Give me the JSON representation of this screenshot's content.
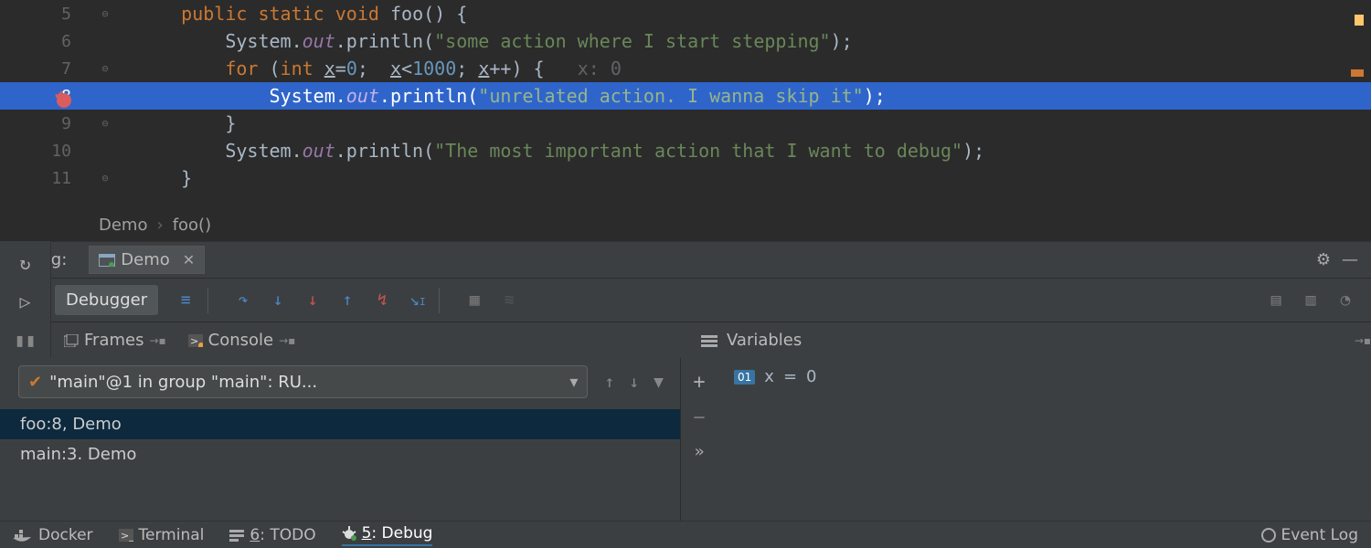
{
  "editor": {
    "lines": [
      {
        "num": "5"
      },
      {
        "num": "6"
      },
      {
        "num": "7",
        "inlay": "x: 0"
      },
      {
        "num": "8"
      },
      {
        "num": "9"
      },
      {
        "num": "10"
      },
      {
        "num": "11"
      }
    ],
    "tokens": {
      "l5_kw1": "public",
      "l5_kw2": "static",
      "l5_kw3": "void",
      "l5_fn": "foo",
      "l5_tail": "() {",
      "l6_pre": "        System.",
      "l6_out": "out",
      "l6_mid": ".println(",
      "l6_str": "\"some action where I start stepping\"",
      "l6_end": ");",
      "l7_pre": "        ",
      "l7_for": "for",
      "l7_a": " (",
      "l7_int": "int",
      "l7_b": " ",
      "l7_x": "x",
      "l7_eq": "=",
      "l7_z": "0",
      "l7_c": ";  ",
      "l7_x2": "x",
      "l7_lt": "<",
      "l7_k": "1000",
      "l7_d": "; ",
      "l7_x3": "x",
      "l7_pp": "++) {",
      "l8_pre": "            System.",
      "l8_out": "out",
      "l8_mid": ".println(",
      "l8_str": "\"unrelated action. I wanna skip it\"",
      "l8_end": ");",
      "l9_pre": "        }",
      "l10_pre": "        System.",
      "l10_out": "out",
      "l10_mid": ".println(",
      "l10_str": "\"The most important action that I want to debug\"",
      "l10_end": ");",
      "l11_pre": "    }"
    }
  },
  "breadcrumb": {
    "cls": "Demo",
    "method": "foo()"
  },
  "debug_header": {
    "label": "Debug:",
    "tab": "Demo"
  },
  "toolbar": {
    "debugger_tab": "Debugger"
  },
  "panel_tabs": {
    "frames": "Frames",
    "console": "Console"
  },
  "frames": {
    "thread": "\"main\"@1 in group \"main\": RU...",
    "items": [
      "foo:8, Demo",
      "main:3. Demo"
    ]
  },
  "variables": {
    "title": "Variables",
    "items": [
      {
        "name": "x",
        "val": "0"
      }
    ]
  },
  "bottom": {
    "docker": "Docker",
    "terminal": "Terminal",
    "todo_u": "6",
    "todo": ": TODO",
    "debug_u": "5",
    "debug": ": Debug",
    "eventlog": "Event Log"
  },
  "icons": {
    "more": "»"
  }
}
